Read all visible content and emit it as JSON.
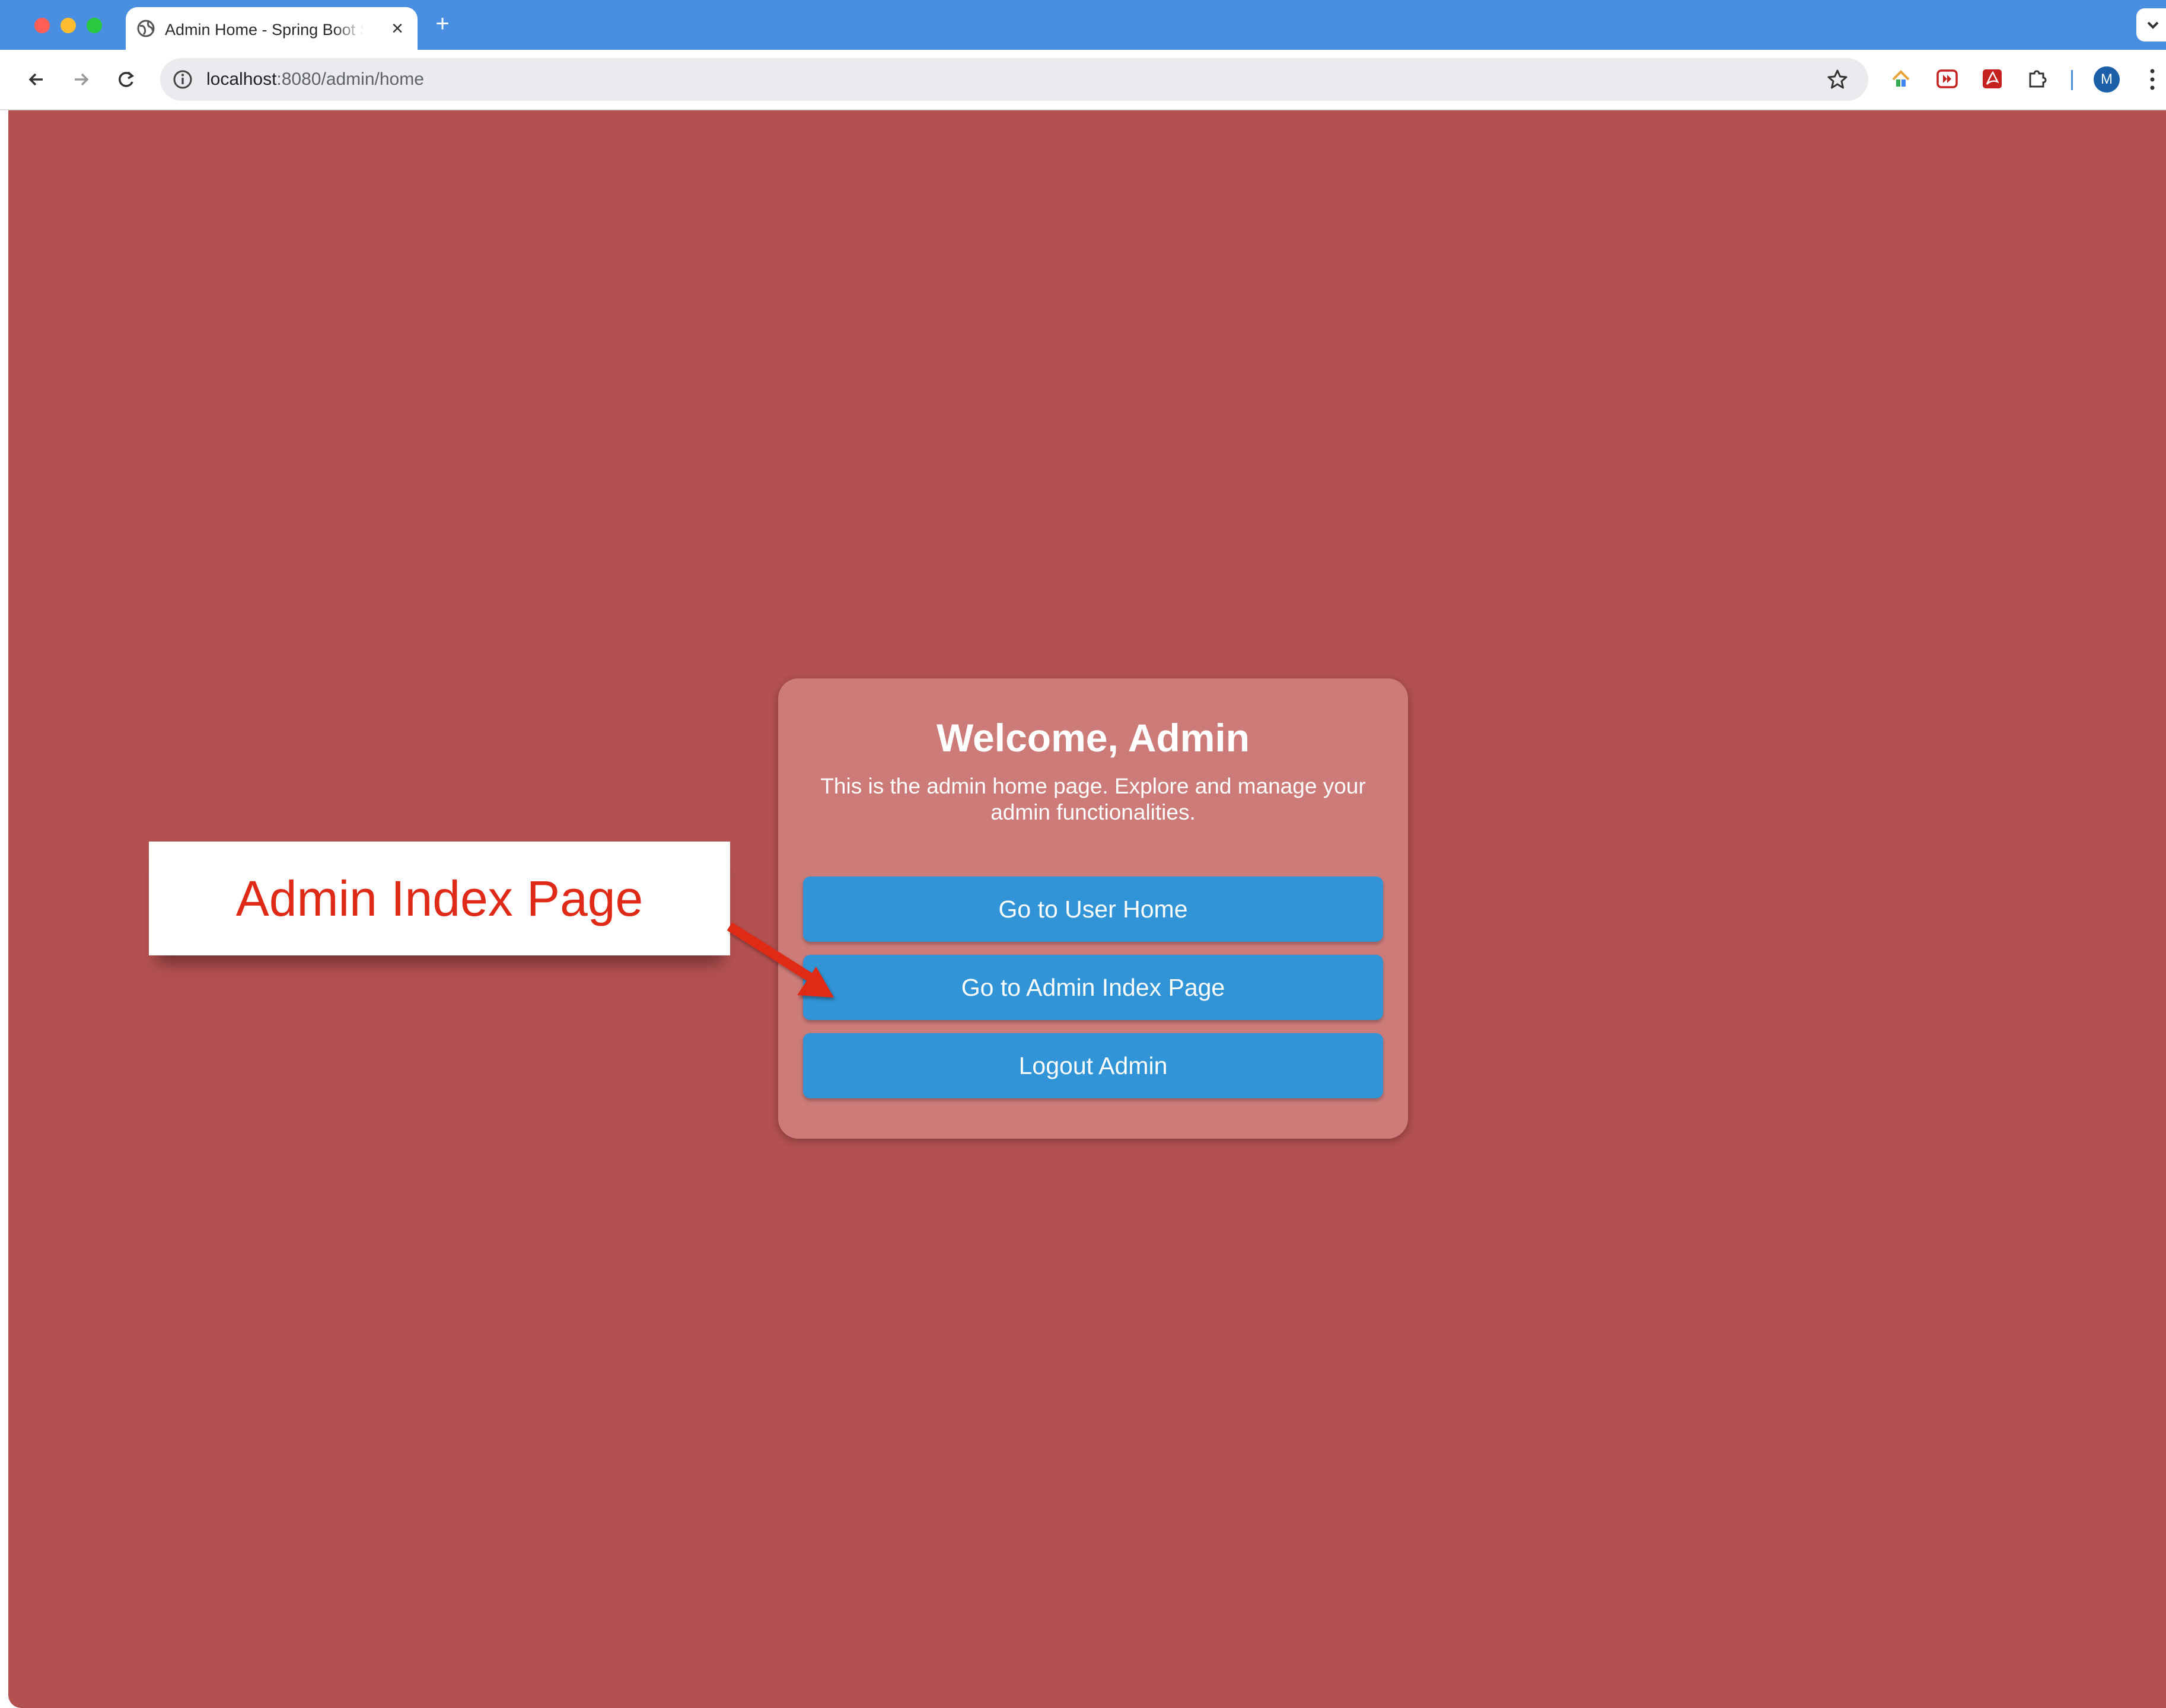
{
  "browser": {
    "tab_title": "Admin Home - Spring Boot Security",
    "url_host": "localhost",
    "url_rest": ":8080/admin/home",
    "avatar_letter": "M",
    "accent_color": "#4a8ee2"
  },
  "page": {
    "background_color": "#b35050",
    "card": {
      "title": "Welcome, Admin",
      "text": "This is the admin home page. Explore and manage your admin functionalities.",
      "buttons": [
        {
          "label": "Go to User Home"
        },
        {
          "label": "Go to Admin Index Page"
        },
        {
          "label": "Logout Admin"
        }
      ]
    }
  },
  "annotation": {
    "callout_text": "Admin Index Page",
    "arrow_color": "#e02a18"
  }
}
